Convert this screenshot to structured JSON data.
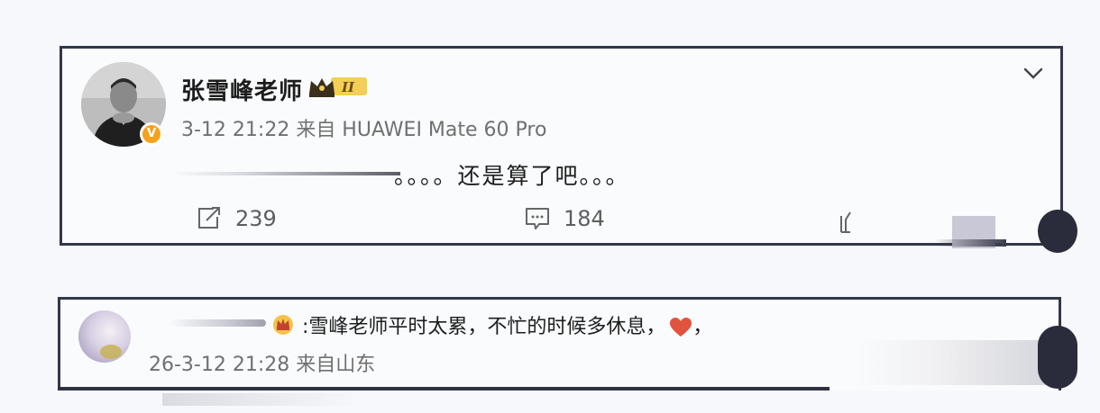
{
  "post": {
    "author_name": "张雪峰老师",
    "level_badge": "II",
    "meta": "3-12 21:22  来自 HUAWEI Mate 60 Pro",
    "content": "。。。。还是算了吧。。。",
    "share_count": "239",
    "comment_count": "184",
    "icons": {
      "share": "share-icon",
      "comment": "comment-icon",
      "like": "like-icon",
      "more": "chevron-down-icon",
      "verified": "verified-v-badge"
    },
    "verified_badge_letter": "V"
  },
  "comment": {
    "text": ":雪峰老师平时太累，不忙的时候多休息，",
    "trailing": "，",
    "meta": "26-3-12 21:28  来自山东",
    "icons": {
      "badge": "crown-badge-icon",
      "heart": "heart-icon"
    }
  },
  "colors": {
    "border": "#33374a",
    "verified": "#f6a21c",
    "heart": "#e0533f"
  }
}
